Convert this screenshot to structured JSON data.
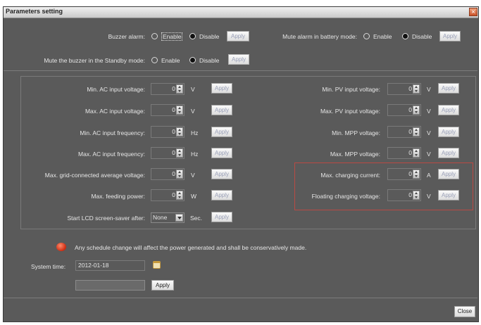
{
  "window": {
    "title": "Parameters setting",
    "close_x": "×"
  },
  "top": {
    "buzzer_label": "Buzzer alarm:",
    "mute_battery_label": "Mute alarm in battery mode:",
    "mute_standby_label": "Mute the buzzer in the Standby mode:",
    "enable": "Enable",
    "disable": "Disable",
    "apply": "Apply",
    "buzzer_selected": "Disable",
    "mute_battery_selected": "Disable",
    "mute_standby_selected": "Disable"
  },
  "left_params": [
    {
      "label": "Min. AC input voltage:",
      "value": "0",
      "unit": "V",
      "apply": "Apply"
    },
    {
      "label": "Max. AC input voltage:",
      "value": "0",
      "unit": "V",
      "apply": "Apply"
    },
    {
      "label": "Min. AC input frequency:",
      "value": "0",
      "unit": "Hz",
      "apply": "Apply"
    },
    {
      "label": "Max. AC input frequency:",
      "value": "0",
      "unit": "Hz",
      "apply": "Apply"
    },
    {
      "label": "Max. grid-connected average voltage:",
      "value": "0",
      "unit": "V",
      "apply": "Apply"
    },
    {
      "label": "Max. feeding power:",
      "value": "0",
      "unit": "W",
      "apply": "Apply"
    }
  ],
  "right_params": [
    {
      "label": "Min. PV input voltage:",
      "value": "0",
      "unit": "V",
      "apply": "Apply"
    },
    {
      "label": "Max. PV input voltage:",
      "value": "0",
      "unit": "V",
      "apply": "Apply"
    },
    {
      "label": "Min. MPP voltage:",
      "value": "0",
      "unit": "V",
      "apply": "Apply"
    },
    {
      "label": "Max. MPP voltage:",
      "value": "0",
      "unit": "V",
      "apply": "Apply"
    },
    {
      "label": "Max. charging current:",
      "value": "0",
      "unit": "A",
      "apply": "Apply"
    },
    {
      "label": "Floating charging voltage:",
      "value": "0",
      "unit": "V",
      "apply": "Apply"
    }
  ],
  "lcd": {
    "label": "Start LCD screen-saver after:",
    "value": "None",
    "unit": "Sec.",
    "apply": "Apply"
  },
  "notice": "Any schedule change will affect the power generated and shall be conservatively made.",
  "system_time": {
    "label": "System time:",
    "value": "2012-01-18"
  },
  "bottom": {
    "apply": "Apply",
    "close": "Close"
  },
  "colors": {
    "window_bg": "#5a5a5a",
    "highlight_border": "#b94a44",
    "close_button": "#c9522a"
  }
}
